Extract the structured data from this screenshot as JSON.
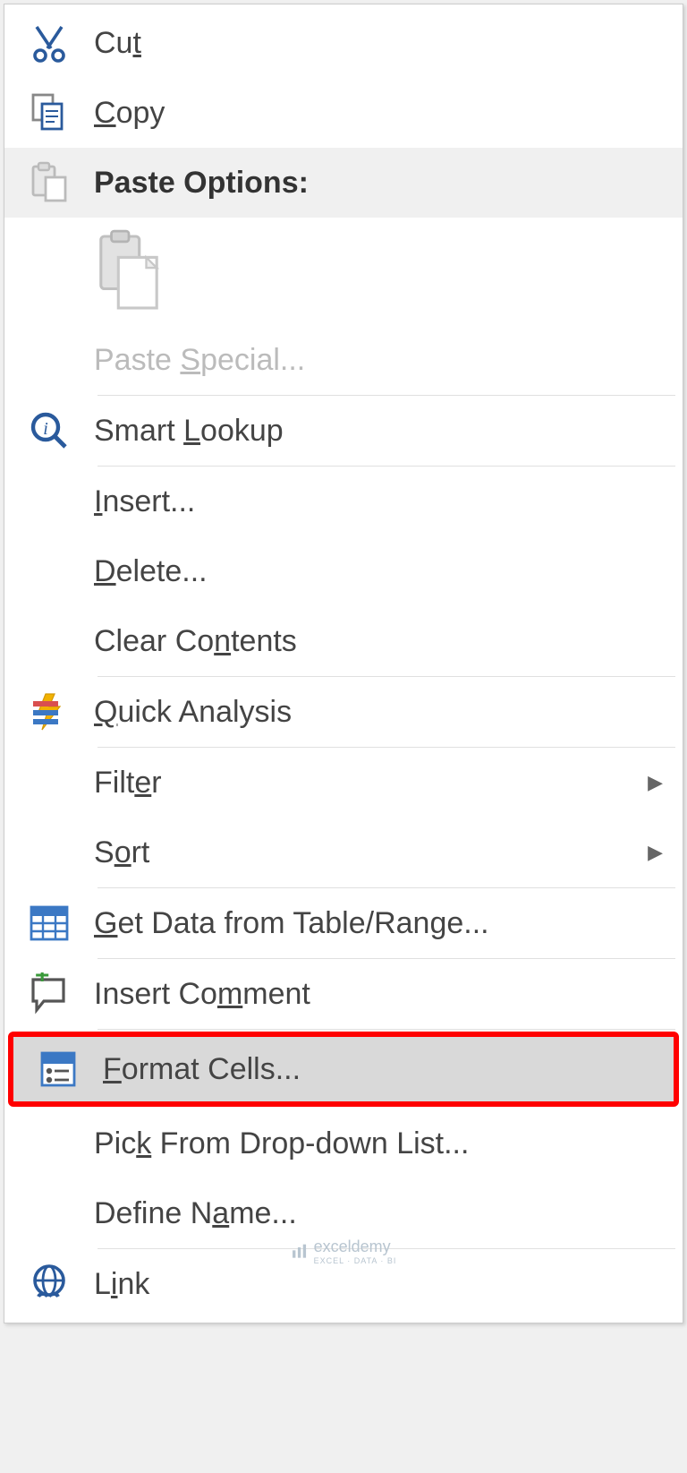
{
  "menu": {
    "cut": {
      "pre": "Cu",
      "m": "t",
      "post": ""
    },
    "copy": {
      "pre": "",
      "m": "C",
      "post": "opy"
    },
    "pasteOptions": {
      "text": "Paste Options:"
    },
    "pasteSpecial": {
      "pre": "Paste ",
      "m": "S",
      "post": "pecial..."
    },
    "smartLookup": {
      "pre": "Smart ",
      "m": "L",
      "post": "ookup"
    },
    "insert": {
      "pre": "",
      "m": "I",
      "post": "nsert..."
    },
    "delete": {
      "pre": "",
      "m": "D",
      "post": "elete..."
    },
    "clearContents": {
      "pre": "Clear Co",
      "m": "n",
      "post": "tents"
    },
    "quickAnalysis": {
      "pre": "",
      "m": "Q",
      "post": "uick Analysis"
    },
    "filter": {
      "pre": "Filt",
      "m": "e",
      "post": "r"
    },
    "sort": {
      "pre": "S",
      "m": "o",
      "post": "rt"
    },
    "getData": {
      "pre": "",
      "m": "G",
      "post": "et Data from Table/Range..."
    },
    "insertComment": {
      "pre": "Insert Co",
      "m": "m",
      "post": "ment"
    },
    "formatCells": {
      "pre": "",
      "m": "F",
      "post": "ormat Cells..."
    },
    "pickFromList": {
      "pre": "Pic",
      "m": "k",
      "post": " From Drop-down List..."
    },
    "defineName": {
      "pre": "Define N",
      "m": "a",
      "post": "me..."
    },
    "link": {
      "pre": "L",
      "m": "i",
      "post": "nk"
    }
  },
  "watermark": {
    "brand": "exceldemy",
    "sub": "EXCEL · DATA · BI"
  }
}
